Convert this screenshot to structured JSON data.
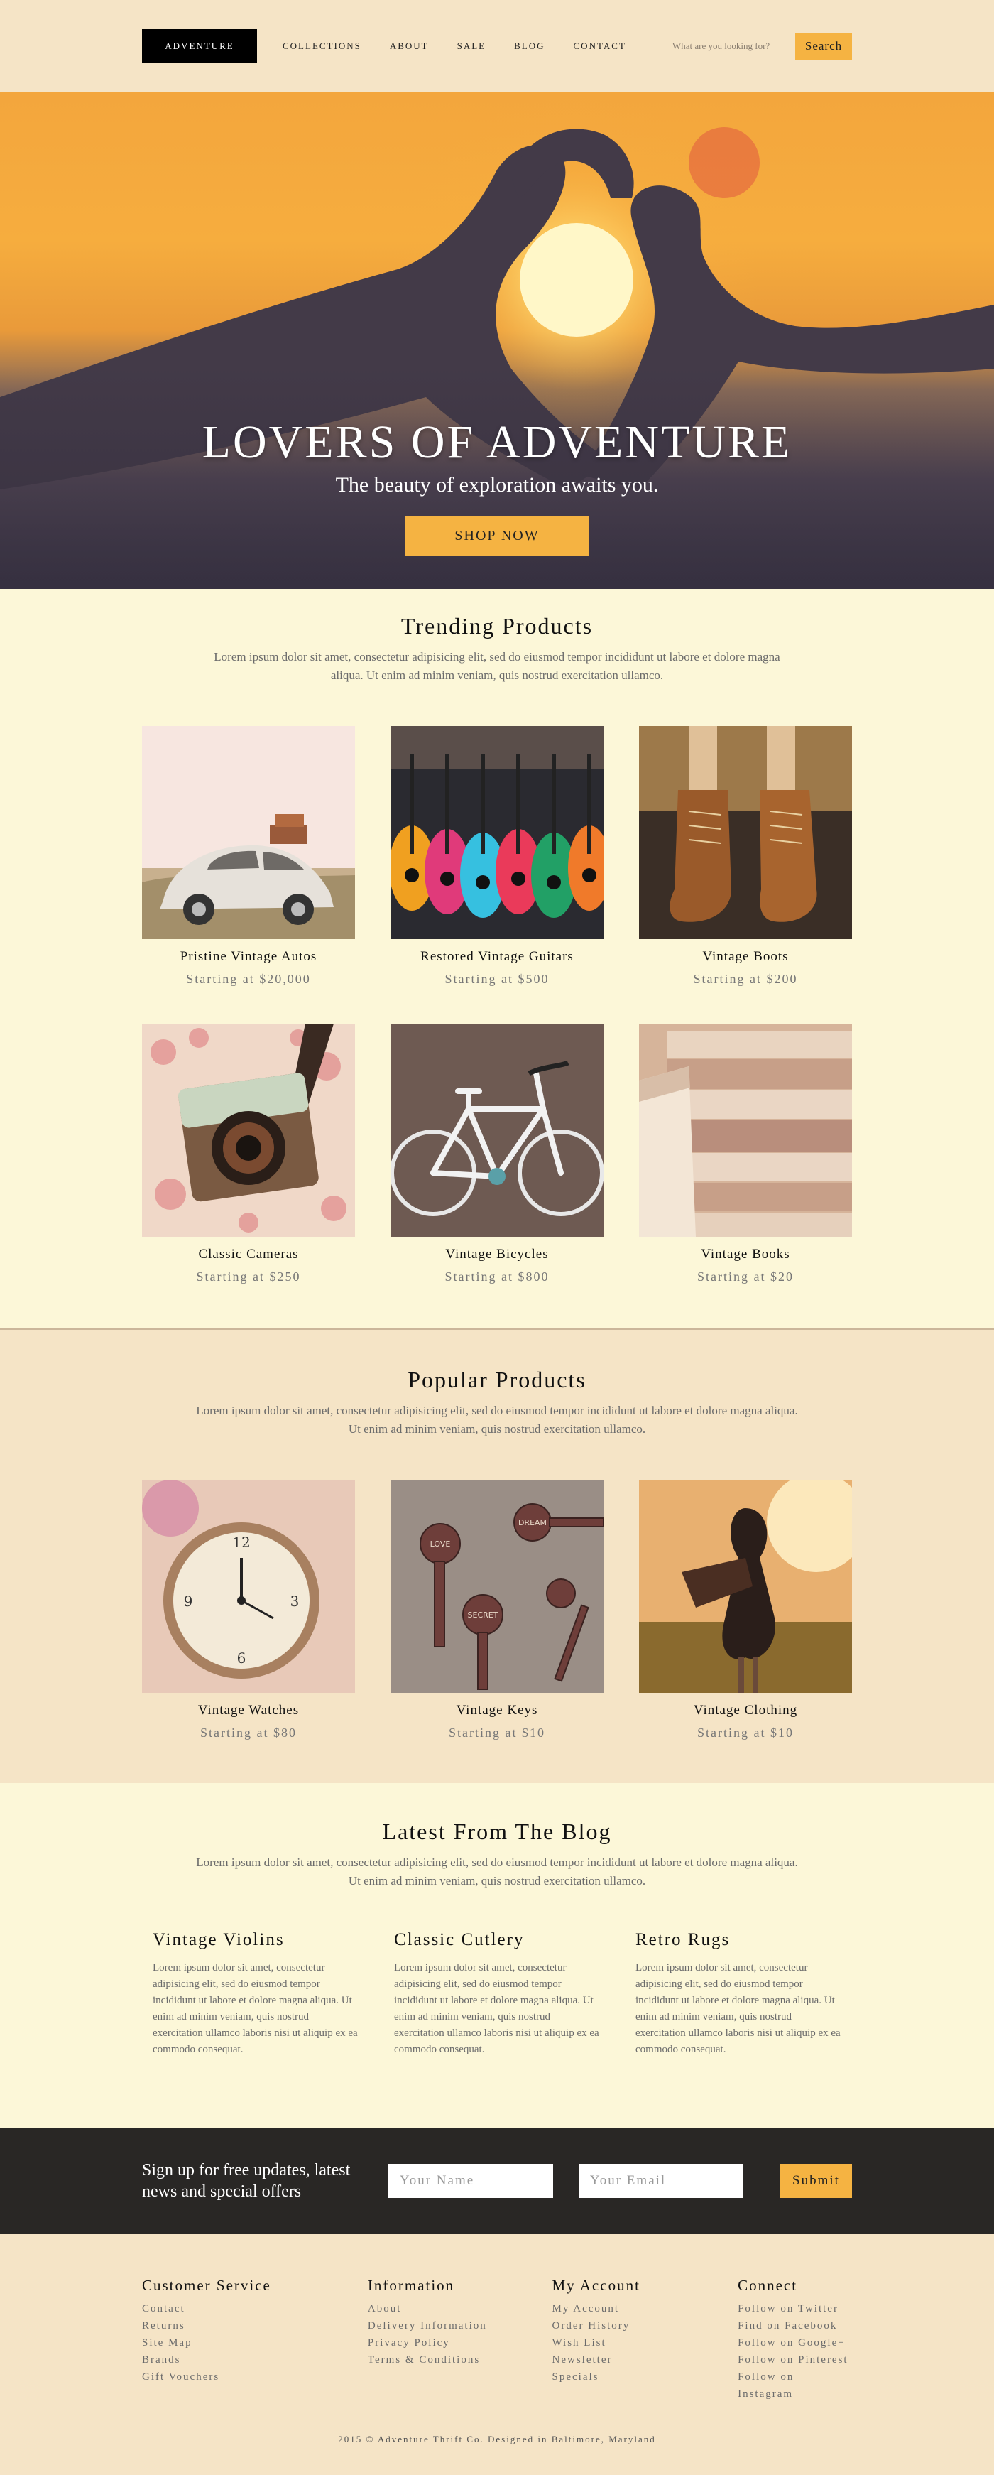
{
  "header": {
    "logo": "ADVENTURE",
    "nav": [
      "COLLECTIONS",
      "ABOUT",
      "SALE",
      "BLOG",
      "CONTACT"
    ],
    "search_placeholder": "What are you looking for?",
    "search_button": "Search"
  },
  "hero": {
    "title": "LOVERS OF ADVENTURE",
    "subtitle": "The beauty of exploration awaits you.",
    "button": "SHOP NOW"
  },
  "trending": {
    "title": "Trending Products",
    "description": "Lorem ipsum dolor sit amet, consectetur adipisicing elit, sed do eiusmod tempor incididunt ut labore et dolore magna aliqua. Ut enim ad minim veniam, quis nostrud exercitation ullamco.",
    "products": [
      {
        "name": "Pristine Vintage Autos",
        "price": "Starting at $20,000"
      },
      {
        "name": "Restored Vintage Guitars",
        "price": "Starting at $500"
      },
      {
        "name": "Vintage Boots",
        "price": "Starting at $200"
      },
      {
        "name": "Classic Cameras",
        "price": "Starting at $250"
      },
      {
        "name": "Vintage Bicycles",
        "price": "Starting at $800"
      },
      {
        "name": "Vintage Books",
        "price": "Starting at $20"
      }
    ]
  },
  "popular": {
    "title": "Popular Products",
    "description_line1": "Lorem ipsum dolor sit amet, consectetur adipisicing elit, sed do eiusmod tempor incididunt ut labore et dolore magna aliqua.",
    "description_line2": "Ut enim ad minim veniam, quis nostrud exercitation ullamco.",
    "products": [
      {
        "name": "Vintage Watches",
        "price": "Starting at $80"
      },
      {
        "name": "Vintage Keys",
        "price": "Starting at $10"
      },
      {
        "name": "Vintage Clothing",
        "price": "Starting at $10"
      }
    ]
  },
  "blog": {
    "title": "Latest From The Blog",
    "description_line1": "Lorem ipsum dolor sit amet, consectetur adipisicing elit, sed do eiusmod tempor incididunt ut labore et dolore magna aliqua.",
    "description_line2": "Ut enim ad minim veniam, quis nostrud exercitation ullamco.",
    "posts": [
      {
        "title": "Vintage Violins",
        "body": "Lorem ipsum dolor sit amet, consectetur adipisicing elit, sed do eiusmod tempor incididunt ut labore et dolore magna aliqua. Ut enim ad minim veniam, quis nostrud exercitation ullamco laboris nisi ut aliquip ex ea commodo consequat."
      },
      {
        "title": "Classic Cutlery",
        "body": "Lorem ipsum dolor sit amet, consectetur adipisicing elit, sed do eiusmod tempor incididunt ut labore et dolore magna aliqua. Ut enim ad minim veniam, quis nostrud exercitation ullamco laboris nisi ut aliquip ex ea commodo consequat."
      },
      {
        "title": "Retro Rugs",
        "body": "Lorem ipsum dolor sit amet, consectetur adipisicing elit, sed do eiusmod tempor incididunt ut labore et dolore magna aliqua. Ut enim ad minim veniam, quis nostrud exercitation ullamco laboris nisi ut aliquip ex ea commodo consequat."
      }
    ]
  },
  "newsletter": {
    "text": "Sign up for free updates, latest news and special offers",
    "name_placeholder": "Your Name",
    "email_placeholder": "Your Email",
    "button": "Submit"
  },
  "footer": {
    "columns": [
      {
        "title": "Customer Service",
        "links": [
          "Contact",
          "Returns",
          "Site Map",
          "Brands",
          "Gift Vouchers"
        ]
      },
      {
        "title": "Information",
        "links": [
          "About",
          "Delivery Information",
          "Privacy Policy",
          "Terms & Conditions"
        ]
      },
      {
        "title": "My Account",
        "links": [
          "My Account",
          "Order History",
          "Wish List",
          "Newsletter",
          "Specials"
        ]
      },
      {
        "title": "Connect",
        "links": [
          "Follow on Twitter",
          "Find on Facebook",
          "Follow on Google+",
          "Follow on Pinterest",
          "Follow on Instagram"
        ]
      }
    ],
    "copyright": "2015 © Adventure Thrift Co. Designed in Baltimore, Maryland"
  },
  "colors": {
    "accent": "#f5b342",
    "header_bg": "#f5e4c6",
    "light_bg": "#fcf7d8",
    "newsletter_bg": "#292725"
  }
}
